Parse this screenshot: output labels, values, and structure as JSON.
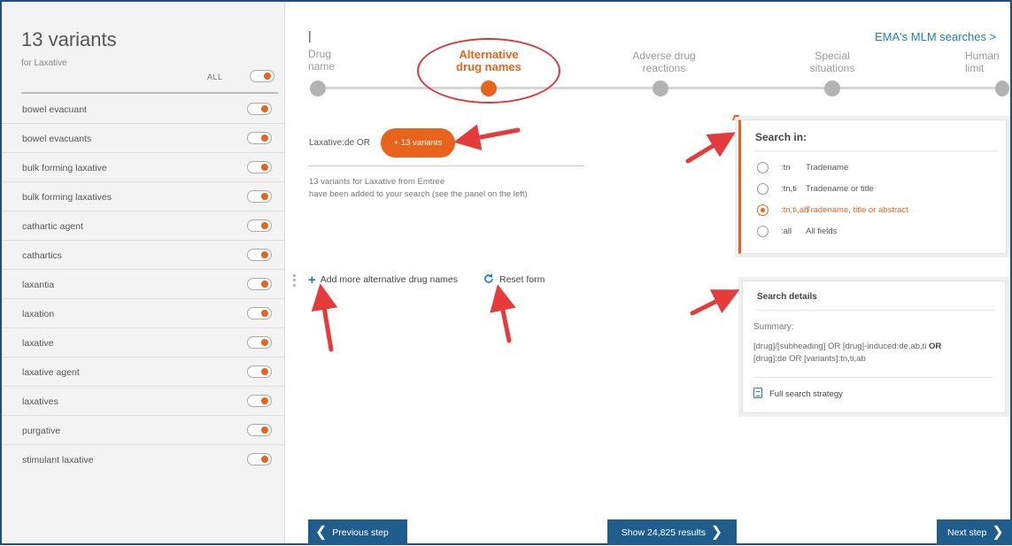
{
  "sidebar": {
    "title": "13 variants",
    "subtitle": "for Laxative",
    "all_label": "ALL",
    "items": [
      {
        "label": "bowel evacuant"
      },
      {
        "label": "bowel evacuants"
      },
      {
        "label": "bulk forming laxative"
      },
      {
        "label": "bulk forming laxatives"
      },
      {
        "label": "cathartic agent"
      },
      {
        "label": "cathartics"
      },
      {
        "label": "laxantia"
      },
      {
        "label": "laxation"
      },
      {
        "label": "laxative"
      },
      {
        "label": "laxative agent"
      },
      {
        "label": "laxatives"
      },
      {
        "label": "purgative"
      },
      {
        "label": "stimulant laxative"
      }
    ]
  },
  "header": {
    "ema_link": "EMA's MLM searches >",
    "steps": [
      {
        "line1": "Drug",
        "line2": "name"
      },
      {
        "line1": "Alternative",
        "line2": "drug names"
      },
      {
        "line1": "Adverse drug",
        "line2": "reactions"
      },
      {
        "line1": "Special",
        "line2": "situations"
      },
      {
        "line1": "Human",
        "line2": "limit"
      }
    ],
    "active_step": 1
  },
  "main": {
    "query_text": "Laxative:de OR",
    "variants_pill": "+ 13 variants",
    "info_line1": "13 variants for Laxative from Emtree",
    "info_line2": "have been added to your search (see the panel on the left)",
    "add_more_label": "Add more alternative drug names",
    "reset_label": "Reset form"
  },
  "search_in": {
    "title": "Search in:",
    "options": [
      {
        "code": ":tn",
        "label": "Tradename",
        "selected": false
      },
      {
        "code": ":tn,ti",
        "label": "Tradename or title",
        "selected": false
      },
      {
        "code": ":tn,ti,ab",
        "label": "Tradename, title or abstract",
        "selected": true
      },
      {
        "code": ":all",
        "label": "All fields",
        "selected": false
      }
    ]
  },
  "search_details": {
    "title": "Search details",
    "summary_label": "Summary:",
    "summary_line1_a": "[drug]/[subheading] OR [drug]-induced:de,ab,ti",
    "summary_line1_b": "OR",
    "summary_line2": "[drug]:de OR [variants]:tn,ti,ab",
    "full_strategy_label": "Full search strategy"
  },
  "footer": {
    "prev_label": "Previous step",
    "show_label": "Show 24,825 results",
    "next_label": "Next step"
  },
  "colors": {
    "accent": "#e8641c",
    "button": "#1f5e8c",
    "link": "#1f7bbf",
    "annotation": "#e53b3b"
  }
}
